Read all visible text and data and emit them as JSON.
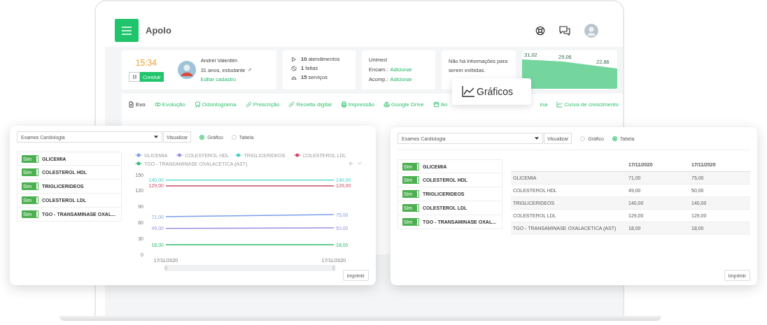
{
  "header": {
    "title": "Apolo"
  },
  "timer": {
    "time": "15:34",
    "finish_button": "Concluir"
  },
  "patient": {
    "name": "Andrei Valentim",
    "details": "31 anos, estudante",
    "gender_symbol": "♂",
    "edit_link": "Editar cadastro"
  },
  "stats": [
    {
      "text": "**10** atendimentos"
    },
    {
      "text": "**1** faltas"
    },
    {
      "text": "**15** serviços"
    }
  ],
  "insurance": {
    "name": "Unimed",
    "lines": [
      {
        "label": "Encam.:",
        "link": "Adicionar"
      },
      {
        "label": "Acomp.:",
        "link": "Adicionar"
      }
    ]
  },
  "notice": "Não há informações para serem exibidas.",
  "mini_chart": {
    "labels": [
      "31,02",
      "29,06",
      "22,86"
    ]
  },
  "tabs": [
    {
      "label": "Evo",
      "selected": true
    },
    {
      "label": "Evolução",
      "selected": false
    },
    {
      "label": "Odontograma",
      "selected": false
    },
    {
      "label": "Prescrição",
      "selected": false
    },
    {
      "label": "Receita digital",
      "selected": false
    },
    {
      "label": "Impressão",
      "selected": false
    },
    {
      "label": "Google Drive",
      "selected": false
    },
    {
      "label": "An",
      "label_end": "ina",
      "selected": false
    },
    {
      "label": "Curva de crescimento",
      "selected": false
    }
  ],
  "popover": {
    "label": "Gráficos"
  },
  "panels": [
    {
      "kind": "chart",
      "select": "Exames Cardiologia",
      "view_button": "Visualizar",
      "options": [
        {
          "label": "Gráfico",
          "selected": true
        },
        {
          "label": "Tabela",
          "selected": false
        }
      ],
      "exams": [
        {
          "toggle": "Sim",
          "on": true,
          "name": "GLICEMIA"
        },
        {
          "toggle": "Sim",
          "on": true,
          "name": "COLESTEROL HDL"
        },
        {
          "toggle": "Sim",
          "on": true,
          "name": "TRIGLICERIDEOS"
        },
        {
          "toggle": "Sim",
          "on": true,
          "name": "COLESTEROL LDL"
        },
        {
          "toggle": "Sim",
          "on": true,
          "name": "TGO - TRANSAMINASE OXAL..."
        }
      ],
      "chart_data": {
        "type": "line",
        "legend": "top",
        "data_labels": true,
        "categories": [
          "17/11/2020",
          "17/11/2020"
        ],
        "ylim": [
          0,
          150
        ],
        "yticks": [
          0,
          30,
          60,
          90,
          120,
          150
        ],
        "series": [
          {
            "name": "GLICEMIA",
            "color": "#7b9ee8",
            "values": [
              71,
              75
            ],
            "value_labels": [
              "71,00",
              "75,00"
            ]
          },
          {
            "name": "COLESTEROL HDL",
            "color": "#9b8fe0",
            "values": [
              49,
              50
            ],
            "value_labels": [
              "49,00",
              "50,00"
            ]
          },
          {
            "name": "TRIGLICERIDEOS",
            "color": "#3fd0c9",
            "values": [
              140,
              140
            ],
            "value_labels": [
              "140,00",
              "140,00"
            ]
          },
          {
            "name": "COLESTEROL LDL",
            "color": "#c94a6a",
            "values": [
              129,
              129
            ],
            "value_labels": [
              "129,00",
              "129,00"
            ]
          },
          {
            "name": "TGO - TRANSAMINASE OXALACETICA (AST)",
            "color": "#2dbd6e",
            "values": [
              18,
              18
            ],
            "value_labels": [
              "18,00",
              "18,00"
            ]
          }
        ]
      },
      "print_button": "Imprimir"
    },
    {
      "kind": "table",
      "select": "Exames Cardiologia",
      "view_button": "Visualizar",
      "options": [
        {
          "label": "Gráfico",
          "selected": false
        },
        {
          "label": "Tabela",
          "selected": true
        }
      ],
      "exams": [
        {
          "toggle": "Sim",
          "on": true,
          "name": "GLICEMIA"
        },
        {
          "toggle": "Sim",
          "on": true,
          "name": "COLESTEROL HDL"
        },
        {
          "toggle": "Sim",
          "on": true,
          "name": "TRIGLICERIDEOS"
        },
        {
          "toggle": "Sim",
          "on": true,
          "name": "COLESTEROL LDL"
        },
        {
          "toggle": "Sim",
          "on": true,
          "name": "TGO - TRANSAMINASE OXAL..."
        }
      ],
      "table": {
        "columns": [
          "17/11/2020",
          "17/11/2020"
        ],
        "rows": [
          {
            "name": "GLICEMIA",
            "values": [
              "71,00",
              "75,00"
            ]
          },
          {
            "name": "COLESTEROL HDL",
            "values": [
              "49,00",
              "50,00"
            ]
          },
          {
            "name": "TRIGLICERIDEOS",
            "values": [
              "140,00",
              "140,00"
            ]
          },
          {
            "name": "COLESTEROL LDL",
            "values": [
              "129,00",
              "129,00"
            ]
          },
          {
            "name": "TGO - TRANSAMINASE OXALACETICA (AST)",
            "values": [
              "18,00",
              "18,00"
            ]
          }
        ]
      },
      "print_button": "Imprimir"
    }
  ]
}
